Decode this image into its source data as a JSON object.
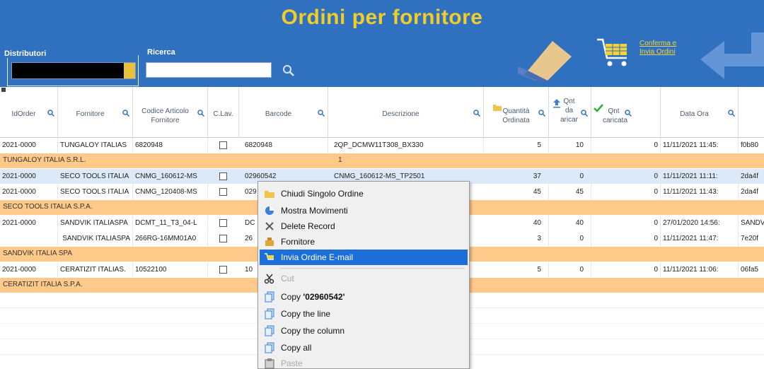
{
  "header": {
    "title": "Ordini per fornitore",
    "distributor_label": "Distributori",
    "search_label": "Ricerca",
    "search_value": "",
    "confirm_line1": "Conferma e",
    "confirm_line2": "Invia Ordini"
  },
  "columns": {
    "id_order": "IdOrder",
    "supplier": "Fornitore",
    "code_line1": "Codice Articolo",
    "code_line2": "Fornitore",
    "c_lav": "C.Lav.",
    "barcode": "Barcode",
    "description": "Descrizione",
    "qty_line1": "Quantità",
    "qty_line2": "Ordinata",
    "qnt_load_1": "Qnt",
    "qnt_load_2": "da",
    "qnt_load_3": "aricar",
    "qnt_loaded_1": "Qnt",
    "qnt_loaded_2": "caricata",
    "date_time": "Data Ora"
  },
  "rows": {
    "r1": {
      "id": "2021-0000",
      "supplier": "TUNGALOY ITALIAS",
      "code": "6820948",
      "barcode": "6820948",
      "desc": "2QP_DCMW11T308_BX330",
      "qty": "5",
      "to_load": "10",
      "loaded": "0",
      "date": "11/11/2021 11:45:",
      "extra": "f0b80"
    },
    "g1": {
      "name": "TUNGALOY ITALIA S.R.L.",
      "count": "1"
    },
    "r2": {
      "id": "2021-0000",
      "supplier": "SECO TOOLS ITALIA",
      "code": "CNMG_160612-MS",
      "barcode": "02960542",
      "desc": "CNMG_160612-MS_TP2501",
      "qty": "37",
      "to_load": "0",
      "loaded": "0",
      "date": "11/11/2021 11:11:",
      "extra": "2da4f"
    },
    "r3": {
      "id": "2021-0000",
      "supplier": "SECO TOOLS ITALIA",
      "code": "CNMG_120408-MS",
      "barcode": "029",
      "desc": "",
      "qty": "45",
      "to_load": "45",
      "loaded": "0",
      "date": "11/11/2021 11:43:",
      "extra": "2da4f"
    },
    "g2": {
      "name": "SECO TOOLS ITALIA S.P.A."
    },
    "r4": {
      "id": "2021-0000",
      "supplier": "SANDVIK ITALIASPA",
      "code": "DCMT_11_T3_04-L",
      "barcode": "DC",
      "desc": "",
      "qty": "40",
      "to_load": "40",
      "loaded": "0",
      "date": "27/01/2020 14:56:",
      "extra": "SANDV"
    },
    "r5": {
      "id": "",
      "supplier": "SANDVIK ITALIASPA",
      "code": "266RG-16MM01A0",
      "barcode": "26",
      "desc": "",
      "qty": "3",
      "to_load": "0",
      "loaded": "0",
      "date": "11/11/2021 11:47:",
      "extra": "7e20f"
    },
    "g3": {
      "name": "SANDVIK ITALIA SPA"
    },
    "r6": {
      "id": "2021-0000",
      "supplier": "CERATIZIT ITALIAS.",
      "code": "10522100",
      "barcode": "10",
      "desc": "",
      "qty": "5",
      "to_load": "0",
      "loaded": "0",
      "date": "11/11/2021 11:06:",
      "extra": "06fa5"
    },
    "g4": {
      "name": "CERATIZIT ITALIA S.P.A."
    }
  },
  "context_menu": {
    "close_order": "Chiudi Singolo Ordine",
    "show_moves": "Mostra Movimenti",
    "delete_record": "Delete Record",
    "supplier": "Fornitore",
    "send_email": "Invia Ordine E-mail",
    "cut": "Cut",
    "copy_value_prefix": "Copy ",
    "copy_value": "'02960542'",
    "copy_line": "Copy the line",
    "copy_column": "Copy the column",
    "copy_all": "Copy all",
    "paste": "Paste"
  },
  "colors": {
    "header_bg": "#2f70bf",
    "title": "#f2cd2a",
    "group_row": "#ffc98a",
    "menu_highlight": "#1c6ed8"
  },
  "icons": [
    "search-icon",
    "eraser-icon",
    "cart-icon",
    "back-arrow-icon",
    "folder-icon",
    "arrow-up-icon",
    "check-icon",
    "scissors-icon",
    "copy-icon",
    "paste-icon"
  ]
}
